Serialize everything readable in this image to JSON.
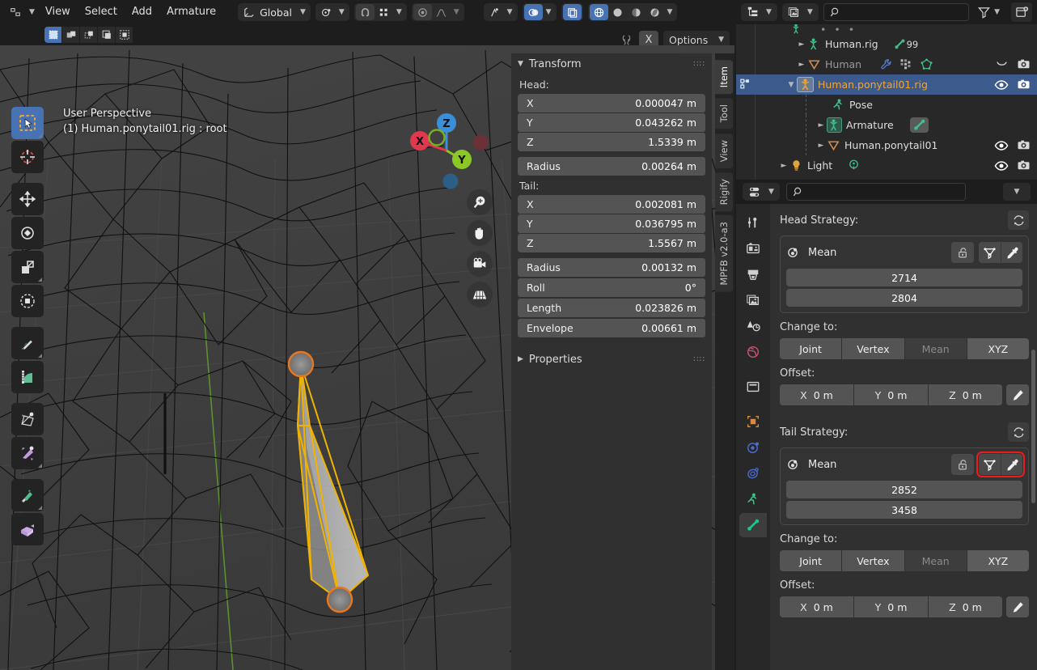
{
  "app": {
    "title": "Blender",
    "theme_accent": "#4772b3",
    "select_color": "#3c5a8c",
    "highlight_red": "#ef1b1b"
  },
  "viewport_header": {
    "editor_type_icon": "editor-type-icon",
    "mode_chevron": "chevron-down-icon",
    "menus": [
      "View",
      "Select",
      "Add",
      "Armature"
    ],
    "orientation": {
      "icon": "transform-orientation-icon",
      "value": "Global",
      "chevron": "chevron-down-icon"
    },
    "pivot": {
      "icon": "pivot-point-icon",
      "chevron": "chevron-down-icon"
    },
    "snap": {
      "magnet_icon": "magnet-icon",
      "snap_to_icon": "snap-to-icon",
      "chevron": "chevron-down-icon"
    },
    "proportional": {
      "icon": "proportional-edit-icon",
      "falloff_icon": "falloff-curve-icon",
      "chevron": "chevron-down-icon"
    },
    "gizmo": {
      "icon": "gizmo-icon",
      "chevron": "chevron-down-icon"
    },
    "overlays": {
      "icon": "overlays-icon",
      "chevron": "chevron-down-icon"
    },
    "xray": {
      "icon": "xray-icon"
    },
    "shading": {
      "wireframe_icon": "shading-wireframe-icon",
      "solid_icon": "shading-solid-icon",
      "material_icon": "shading-material-icon",
      "rendered_icon": "shading-rendered-icon",
      "chevron": "chevron-down-icon"
    },
    "select_modes": [
      "set-select-icon",
      "extend-select-icon",
      "subtract-select-icon",
      "invert-select-icon",
      "intersect-select-icon"
    ],
    "mirror": {
      "icon": "armature-mirror-icon",
      "axis_label": "X"
    },
    "options": {
      "label": "Options",
      "chevron": "chevron-down-icon"
    }
  },
  "viewport": {
    "perspective_label": "User Perspective",
    "scene_label": "(1) Human.ponytail01.rig : root",
    "gizmo_axes": [
      {
        "label": "Z",
        "color": "#3b8fd8"
      },
      {
        "label": "X",
        "color": "#e0384f"
      },
      {
        "label": "Y",
        "color": "#8bc825"
      }
    ],
    "nav_buttons": [
      "zoom-icon",
      "pan-hand-icon",
      "camera-icon",
      "grid-ortho-icon"
    ],
    "toolbar": [
      {
        "name": "tweak-select-box-tool",
        "active": true
      },
      {
        "name": "cursor-tool",
        "active": false
      },
      {
        "name": "move-tool",
        "active": false
      },
      {
        "name": "rotate-tool",
        "active": false
      },
      {
        "name": "scale-tool",
        "active": false
      },
      {
        "name": "transform-tool",
        "active": false
      },
      {
        "name": "annotate-tool",
        "active": false
      },
      {
        "name": "measure-tool",
        "active": false
      },
      {
        "name": "extrude-bone-tool",
        "active": false
      },
      {
        "name": "bone-size-tool",
        "active": false
      },
      {
        "name": "bone-roll-tool",
        "active": false
      },
      {
        "name": "extrude-tool",
        "active": false
      }
    ]
  },
  "npanel": {
    "tabs": [
      {
        "label": "Item",
        "active": true
      },
      {
        "label": "Tool",
        "active": false
      },
      {
        "label": "View",
        "active": false
      },
      {
        "label": "Rigify",
        "active": false
      },
      {
        "label": "MPFB v2.0-a3",
        "active": false
      }
    ],
    "transform": {
      "title": "Transform",
      "expanded": true,
      "head_label": "Head:",
      "head": [
        {
          "key": "X",
          "value": "0.000047 m"
        },
        {
          "key": "Y",
          "value": "0.043262 m"
        },
        {
          "key": "Z",
          "value": "1.5339 m"
        }
      ],
      "head_radius": {
        "key": "Radius",
        "value": "0.00264 m"
      },
      "tail_label": "Tail:",
      "tail": [
        {
          "key": "X",
          "value": "0.002081 m"
        },
        {
          "key": "Y",
          "value": "0.036795 m"
        },
        {
          "key": "Z",
          "value": "1.5567 m"
        }
      ],
      "tail_extra": [
        {
          "key": "Radius",
          "value": "0.00132 m"
        },
        {
          "key": "Roll",
          "value": "0°"
        },
        {
          "key": "Length",
          "value": "0.023826 m"
        },
        {
          "key": "Envelope",
          "value": "0.00661 m"
        }
      ]
    },
    "properties_panel": {
      "title": "Properties",
      "expanded": false
    }
  },
  "outliner": {
    "header": {
      "display_mode_icon": "outliner-display-mode-icon",
      "display_mode_chevron": "chevron-down-icon",
      "filter_id_icon": "id-type-icon",
      "filter_id_chevron": "chevron-down-icon",
      "search_icon": "search-icon",
      "search_value": "",
      "search_placeholder": "",
      "filter_icon": "filter-funnel-icon",
      "filter_chevron": "chevron-down-icon",
      "new_collection_icon": "new-collection-icon"
    },
    "rows": [
      {
        "indent": 2,
        "disclosure": "►",
        "icon": "armature-data-icon",
        "icon_color": "#3ec08a",
        "label": "Human.rig",
        "dim": false,
        "selected": false,
        "badge": "99",
        "badge_icon": "bone-icon",
        "extra_icons": [],
        "right_icons": []
      },
      {
        "indent": 2,
        "disclosure": "►",
        "icon": "mesh-object-icon",
        "icon_color": "#d08a4a",
        "label": "Human",
        "dim": true,
        "selected": false,
        "badge": "",
        "extra_icons": [
          "modifier-wrench-icon",
          "vertex-group-icon",
          "mesh-data-icon"
        ],
        "right_icons": [
          "collapsed-dropdown-icon",
          "render-camera-icon"
        ]
      },
      {
        "indent": 1,
        "disclosure": "▼",
        "icon": "armature-object-icon",
        "icon_color": "#e8a33d",
        "label": "Human.ponytail01.rig",
        "dim": false,
        "selected": true,
        "badge": "",
        "extra_icons": [],
        "right_icons": [
          "eye-icon",
          "render-camera-icon"
        ]
      },
      {
        "indent": 3,
        "disclosure": "",
        "icon": "pose-icon",
        "icon_color": "#3ec08a",
        "label": "Pose",
        "dim": false,
        "selected": false,
        "badge": "",
        "extra_icons": [],
        "right_icons": []
      },
      {
        "indent": 2,
        "disclosure": "►",
        "icon": "armature-data-icon",
        "icon_color": "#3ec08a",
        "label": "Armature",
        "dim": false,
        "selected": false,
        "badge": "",
        "extra_icons": [
          "bone-icon"
        ],
        "right_icons": []
      },
      {
        "indent": 2,
        "disclosure": "►",
        "icon": "mesh-object-icon",
        "icon_color": "#d08a4a",
        "label": "Human.ponytail01",
        "dim": false,
        "selected": false,
        "badge": "",
        "extra_icons": [],
        "right_icons": [
          "eye-icon",
          "render-camera-icon"
        ]
      },
      {
        "indent": 1,
        "disclosure": "►",
        "icon": "light-object-icon",
        "icon_color": "#d9a13c",
        "label": "Light",
        "dim": false,
        "selected": false,
        "badge": "",
        "extra_icons": [
          "light-data-icon"
        ],
        "right_icons": [
          "eye-icon",
          "render-camera-icon"
        ]
      }
    ]
  },
  "properties": {
    "header": {
      "editor_icon": "properties-editor-icon",
      "editor_chevron": "chevron-down-icon",
      "search_icon": "search-icon",
      "search_value": "",
      "options_chevron": "chevron-down-icon"
    },
    "tabs": [
      {
        "name": "tool-tab",
        "icon": "tool-screwdriver-wrench-icon",
        "active": false
      },
      {
        "name": "render-tab",
        "icon": "render-camera-back-icon",
        "active": false
      },
      {
        "name": "output-tab",
        "icon": "output-printer-icon",
        "active": false
      },
      {
        "name": "view-layer-tab",
        "icon": "view-layer-images-icon",
        "active": false
      },
      {
        "name": "scene-tab",
        "icon": "scene-cone-icon",
        "active": false
      },
      {
        "name": "world-tab",
        "icon": "world-globe-icon",
        "active": false
      },
      {
        "name": "collection-tab",
        "icon": "collection-box-icon",
        "active": false
      },
      {
        "name": "object-tab",
        "icon": "object-orange-square-icon",
        "active": false
      },
      {
        "name": "modifiers-tab",
        "icon": "physics-orbit-icon",
        "active": false
      },
      {
        "name": "constraints-tab",
        "icon": "constraints-clamp-icon",
        "active": false
      },
      {
        "name": "object-data-tab",
        "icon": "armature-running-man-icon",
        "active": false
      },
      {
        "name": "bone-tab",
        "icon": "bone-icon",
        "active": true
      }
    ],
    "sections": [
      {
        "title": "Head Strategy:",
        "refresh_icon": "refresh-icon",
        "strategy": {
          "icon": "strategy-link-icon",
          "name": "Mean",
          "lock_icon": "lock-open-icon",
          "vertex_icon": "vertex-select-icon",
          "eyedropper_icon": "eyedropper-icon",
          "highlighted": false,
          "values": [
            "2714",
            "2804"
          ]
        },
        "change_to_label": "Change to:",
        "change_to_options": [
          {
            "label": "Joint",
            "state": "normal"
          },
          {
            "label": "Vertex",
            "state": "normal"
          },
          {
            "label": "Mean",
            "state": "disabled"
          },
          {
            "label": "XYZ",
            "state": "highlight"
          }
        ],
        "offset_label": "Offset:",
        "offset": [
          {
            "key": "X",
            "value": "0 m"
          },
          {
            "key": "Y",
            "value": "0 m"
          },
          {
            "key": "Z",
            "value": "0 m"
          }
        ],
        "offset_pen_icon": "pencil-icon"
      },
      {
        "title": "Tail Strategy:",
        "refresh_icon": "refresh-icon",
        "strategy": {
          "icon": "strategy-link-icon",
          "name": "Mean",
          "lock_icon": "lock-open-icon",
          "vertex_icon": "vertex-select-icon",
          "eyedropper_icon": "eyedropper-icon",
          "highlighted": true,
          "values": [
            "2852",
            "3458"
          ]
        },
        "change_to_label": "Change to:",
        "change_to_options": [
          {
            "label": "Joint",
            "state": "normal"
          },
          {
            "label": "Vertex",
            "state": "normal"
          },
          {
            "label": "Mean",
            "state": "disabled"
          },
          {
            "label": "XYZ",
            "state": "highlight"
          }
        ],
        "offset_label": "Offset:",
        "offset": [
          {
            "key": "X",
            "value": "0 m"
          },
          {
            "key": "Y",
            "value": "0 m"
          },
          {
            "key": "Z",
            "value": "0 m"
          }
        ],
        "offset_pen_icon": "pencil-icon"
      }
    ]
  }
}
